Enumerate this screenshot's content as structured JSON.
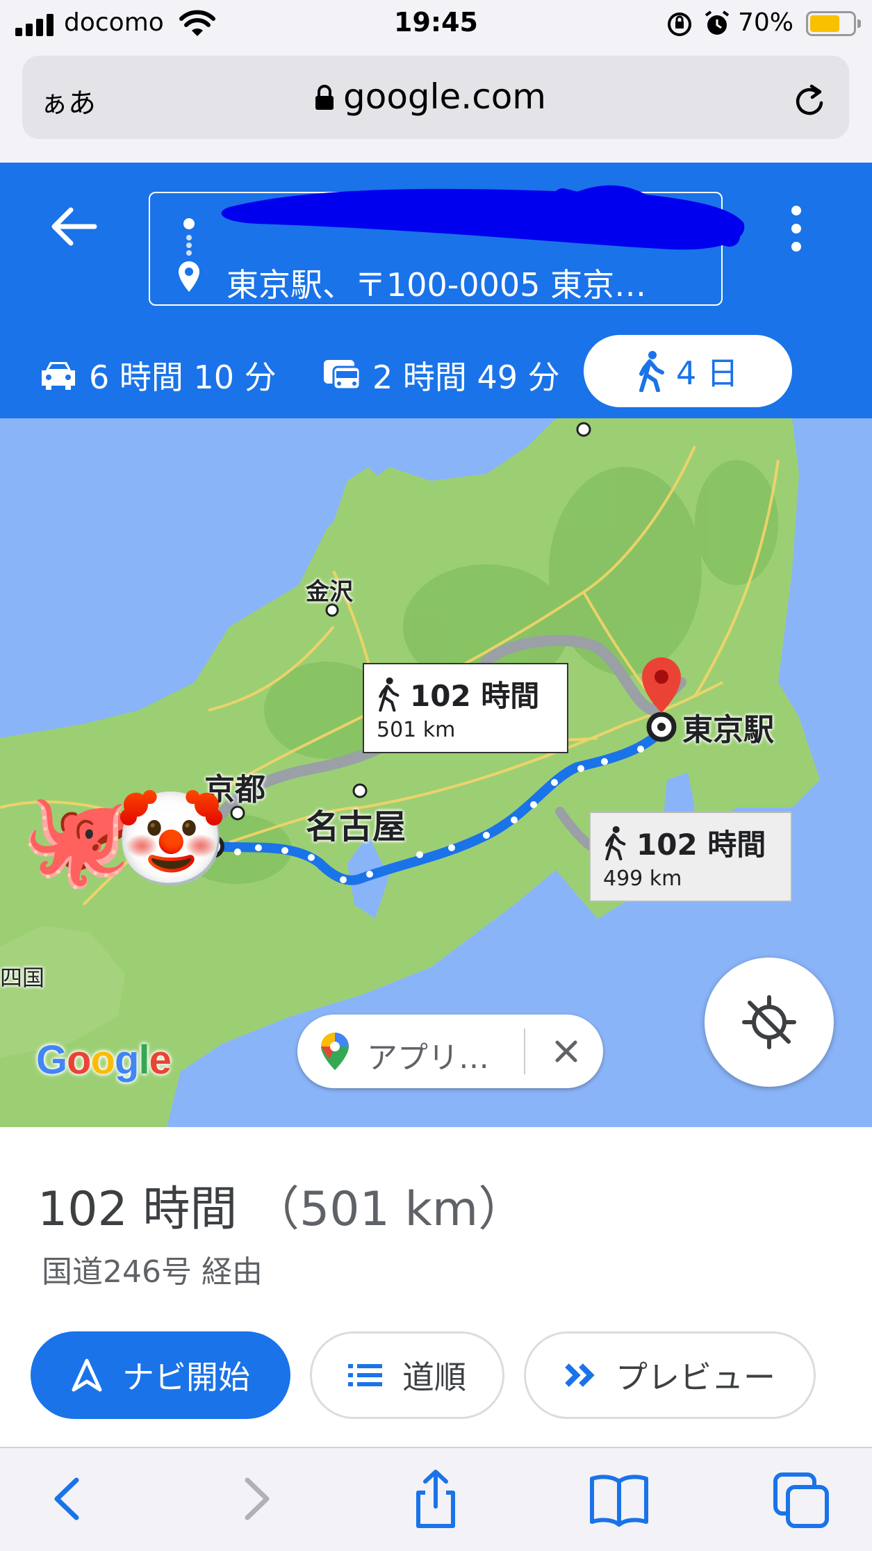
{
  "status_bar": {
    "carrier": "docomo",
    "time": "19:45",
    "battery_percent_label": "70%",
    "battery_level": 0.7,
    "icons": [
      "signal-bars-icon",
      "wifi-icon",
      "rotation-lock-icon",
      "alarm-icon",
      "battery-icon"
    ]
  },
  "safari": {
    "text_size_label": "ぁあ",
    "domain": "google.com",
    "toolbar_icons": [
      "back-icon",
      "forward-icon",
      "share-icon",
      "bookmarks-icon",
      "tabs-icon"
    ]
  },
  "directions": {
    "destination": "東京駅、〒100-0005 東京…",
    "modes": [
      {
        "name": "car",
        "icon": "car-icon",
        "label": "6 時間 10 分"
      },
      {
        "name": "transit",
        "icon": "transit-icon",
        "label": "2 時間 49 分"
      },
      {
        "name": "walk",
        "icon": "walk-icon",
        "label": "4 日",
        "selected": true
      }
    ]
  },
  "map": {
    "cities": {
      "kanazawa": "金沢",
      "kyoto": "京都",
      "nagoya": "名古屋",
      "tokyo_station": "東京駅",
      "shikoku": "四国"
    },
    "routes": [
      {
        "time": "102 時間",
        "distance": "501 km",
        "selected": true
      },
      {
        "time": "102 時間",
        "distance": "499 km",
        "selected": false
      }
    ],
    "emoji": {
      "octopus": "🐙",
      "clown": "🤡"
    },
    "google_logo": [
      "G",
      "o",
      "o",
      "g",
      "l",
      "e"
    ],
    "app_chip_label": "アプリ…",
    "colors": {
      "route": "#1a73e8",
      "alt_route": "#9aa0a6",
      "land": "#9ccf74",
      "sea": "#8ab4f8",
      "pin": "#ea4335"
    }
  },
  "summary": {
    "time": "102 時間",
    "distance": "（501 km）",
    "via": "国道246号 経由"
  },
  "actions": {
    "start": "ナビ開始",
    "steps": "道順",
    "preview": "プレビュー"
  }
}
